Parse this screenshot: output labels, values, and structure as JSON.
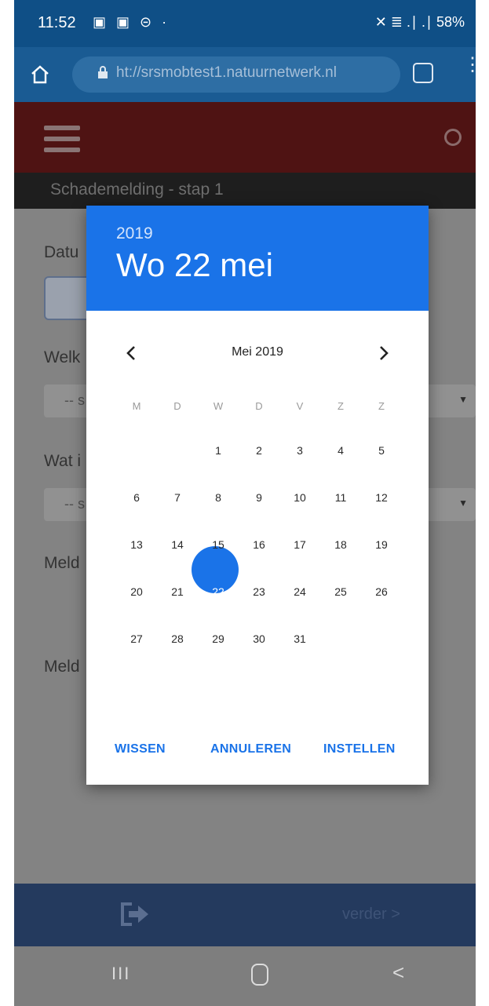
{
  "status_bar": {
    "time": "11:52",
    "status_icons": "▣ ▣ ⊝ ·",
    "right_text": "✕ ≣ .∣ .∣ 58%"
  },
  "browser": {
    "url": "ht://srsmobtest1.natuurnetwerk.nl",
    "colors": {
      "toolbar": "#1a5b93"
    }
  },
  "app_bar": {
    "colors": {
      "background": "#4f1313"
    }
  },
  "page": {
    "subtitle": "Schademelding - stap 1",
    "fields": [
      {
        "label": "Datu"
      },
      {
        "label": "Welk"
      },
      {
        "label": "Wat i"
      },
      {
        "label": "Meld"
      },
      {
        "label": "Meld"
      }
    ],
    "selects": [
      {
        "placeholder": "-- s"
      },
      {
        "placeholder": "-- s"
      }
    ]
  },
  "datepicker": {
    "year": "2019",
    "selected_long": "Wo 22 mei",
    "month_label": "Mei 2019",
    "weekdays": [
      "M",
      "D",
      "W",
      "D",
      "V",
      "Z",
      "Z"
    ],
    "first_weekday_index": 2,
    "days_in_month": 31,
    "selected_day": 22,
    "days": [
      "1",
      "2",
      "3",
      "4",
      "5",
      "6",
      "7",
      "8",
      "9",
      "10",
      "11",
      "12",
      "13",
      "14",
      "15",
      "16",
      "17",
      "18",
      "19",
      "20",
      "21",
      "22",
      "23",
      "24",
      "25",
      "26",
      "27",
      "28",
      "29",
      "30",
      "31"
    ],
    "actions": {
      "clear": "WISSEN",
      "cancel": "ANNULEREN",
      "set": "INSTELLEN"
    },
    "colors": {
      "accent": "#1a73e8"
    }
  },
  "bottom_bar": {
    "next_label": "verder >"
  },
  "system_nav": {
    "recents": "III",
    "back": "<"
  }
}
